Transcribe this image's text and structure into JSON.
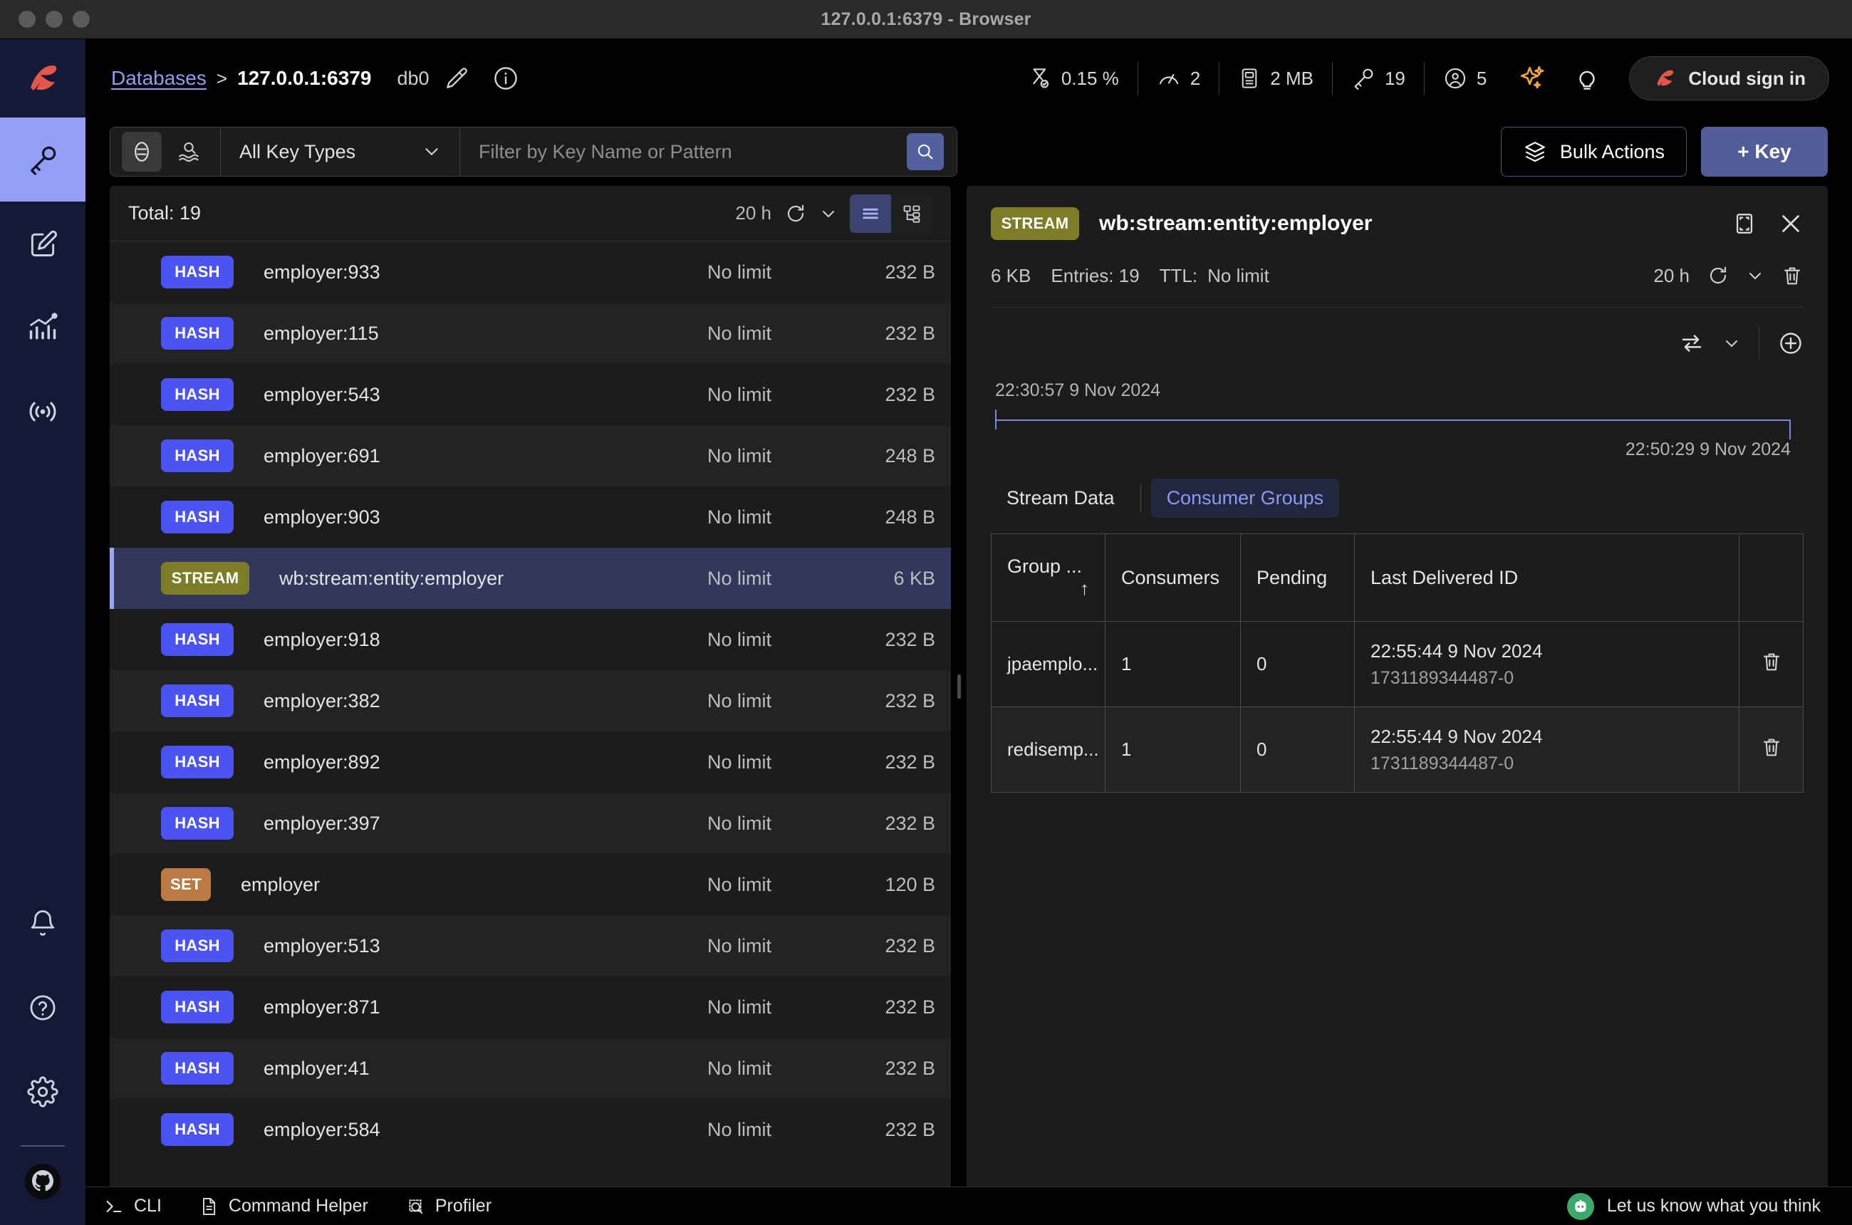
{
  "window": {
    "title": "127.0.0.1:6379 - Browser"
  },
  "rail": {
    "logo": "redis-logo",
    "items": [
      {
        "name": "browser",
        "icon": "key-icon",
        "active": true
      },
      {
        "name": "workbench",
        "icon": "edit-document-icon",
        "active": false
      },
      {
        "name": "analytics",
        "icon": "bar-chart-icon",
        "active": false
      },
      {
        "name": "pubsub",
        "icon": "broadcast-icon",
        "active": false
      }
    ],
    "bottom_items": [
      {
        "name": "notifications",
        "icon": "bell-icon"
      },
      {
        "name": "help",
        "icon": "question-circle-icon"
      },
      {
        "name": "settings",
        "icon": "gear-icon"
      },
      {
        "name": "github",
        "icon": "github-icon"
      }
    ]
  },
  "header": {
    "breadcrumb_link": "Databases",
    "breadcrumb_separator": ">",
    "breadcrumb_current": "127.0.0.1:6379",
    "database_index": "db0",
    "edit_icon": "pencil-icon",
    "info_icon": "info-circle-icon",
    "metrics": [
      {
        "name": "cpu",
        "icon": "hourglass-icon",
        "value": "0.15 %"
      },
      {
        "name": "commands-per-sec",
        "icon": "gauge-icon",
        "value": "2"
      },
      {
        "name": "memory",
        "icon": "memory-chip-icon",
        "value": "2 MB"
      },
      {
        "name": "keys",
        "icon": "key-icon",
        "value": "19"
      },
      {
        "name": "connected-clients",
        "icon": "user-circle-icon",
        "value": "5"
      }
    ],
    "ai_icon": "sparkles-icon",
    "tips_icon": "lightbulb-icon",
    "cloud_button": "Cloud sign in"
  },
  "toolbar": {
    "filter_toggle_icon": "filter-icon",
    "scan_icon": "scan-layers-icon",
    "key_type_selected": "All Key Types",
    "chevron_icon": "chevron-down-icon",
    "search_placeholder": "Filter by Key Name or Pattern",
    "search_value": "",
    "search_icon": "search-icon",
    "bulk_actions_label": "Bulk Actions",
    "bulk_actions_icon": "layers-icon",
    "add_key_label": "+ Key"
  },
  "keys_panel": {
    "total_label": "Total: 19",
    "ttl_label": "20 h",
    "refresh_icon": "refresh-icon",
    "chevron_icon": "chevron-down-icon",
    "view_list_icon": "list-view-icon",
    "view_tree_icon": "tree-view-icon",
    "rows": [
      {
        "type": "HASH",
        "name": "employer:933",
        "ttl": "No limit",
        "size": "232 B",
        "selected": false
      },
      {
        "type": "HASH",
        "name": "employer:115",
        "ttl": "No limit",
        "size": "232 B",
        "selected": false
      },
      {
        "type": "HASH",
        "name": "employer:543",
        "ttl": "No limit",
        "size": "232 B",
        "selected": false
      },
      {
        "type": "HASH",
        "name": "employer:691",
        "ttl": "No limit",
        "size": "248 B",
        "selected": false
      },
      {
        "type": "HASH",
        "name": "employer:903",
        "ttl": "No limit",
        "size": "248 B",
        "selected": false
      },
      {
        "type": "STREAM",
        "name": "wb:stream:entity:employer",
        "ttl": "No limit",
        "size": "6 KB",
        "selected": true
      },
      {
        "type": "HASH",
        "name": "employer:918",
        "ttl": "No limit",
        "size": "232 B",
        "selected": false
      },
      {
        "type": "HASH",
        "name": "employer:382",
        "ttl": "No limit",
        "size": "232 B",
        "selected": false
      },
      {
        "type": "HASH",
        "name": "employer:892",
        "ttl": "No limit",
        "size": "232 B",
        "selected": false
      },
      {
        "type": "HASH",
        "name": "employer:397",
        "ttl": "No limit",
        "size": "232 B",
        "selected": false
      },
      {
        "type": "SET",
        "name": "employer",
        "ttl": "No limit",
        "size": "120 B",
        "selected": false
      },
      {
        "type": "HASH",
        "name": "employer:513",
        "ttl": "No limit",
        "size": "232 B",
        "selected": false
      },
      {
        "type": "HASH",
        "name": "employer:871",
        "ttl": "No limit",
        "size": "232 B",
        "selected": false
      },
      {
        "type": "HASH",
        "name": "employer:41",
        "ttl": "No limit",
        "size": "232 B",
        "selected": false
      },
      {
        "type": "HASH",
        "name": "employer:584",
        "ttl": "No limit",
        "size": "232 B",
        "selected": false
      }
    ]
  },
  "detail": {
    "type_badge": "STREAM",
    "key_name": "wb:stream:entity:employer",
    "fullscreen_icon": "fullscreen-icon",
    "close_icon": "close-icon",
    "size": "6 KB",
    "entries_label": "Entries: 19",
    "ttl_prefix": "TTL:",
    "ttl_value": "No limit",
    "ttl_timer": "20 h",
    "refresh_icon": "refresh-icon",
    "chevron_icon": "chevron-down-icon",
    "delete_icon": "trash-icon",
    "sort_icon": "sort-order-icon",
    "add_entry_icon": "plus-circle-icon",
    "range_start": "22:30:57 9 Nov 2024",
    "range_end": "22:50:29 9 Nov 2024",
    "tabs": [
      {
        "label": "Stream Data",
        "active": false
      },
      {
        "label": "Consumer Groups",
        "active": true
      }
    ],
    "table": {
      "columns": [
        "Group ...",
        "Consumers",
        "Pending",
        "Last Delivered ID",
        ""
      ],
      "sort_arrow": "↑",
      "rows": [
        {
          "group": "jpaemplo...",
          "consumers": "1",
          "pending": "0",
          "last_time": "22:55:44 9 Nov 2024",
          "last_id": "1731189344487-0",
          "delete_icon": "trash-icon"
        },
        {
          "group": "redisemp...",
          "consumers": "1",
          "pending": "0",
          "last_time": "22:55:44 9 Nov 2024",
          "last_id": "1731189344487-0",
          "delete_icon": "trash-icon"
        }
      ]
    }
  },
  "statusbar": {
    "cli_label": "CLI",
    "cli_icon": "terminal-icon",
    "command_helper_label": "Command Helper",
    "command_helper_icon": "document-icon",
    "profiler_label": "Profiler",
    "profiler_icon": "profiler-icon",
    "feedback_label": "Let us know what you think",
    "feedback_icon": "feedback-robot-icon"
  },
  "colors": {
    "accent": "#8c99f2",
    "brand": "#e4564a",
    "hash_badge": "#4b54f2",
    "stream_badge": "#7d7d27",
    "set_badge": "#bb7a44",
    "selected_row": "#32385c"
  }
}
